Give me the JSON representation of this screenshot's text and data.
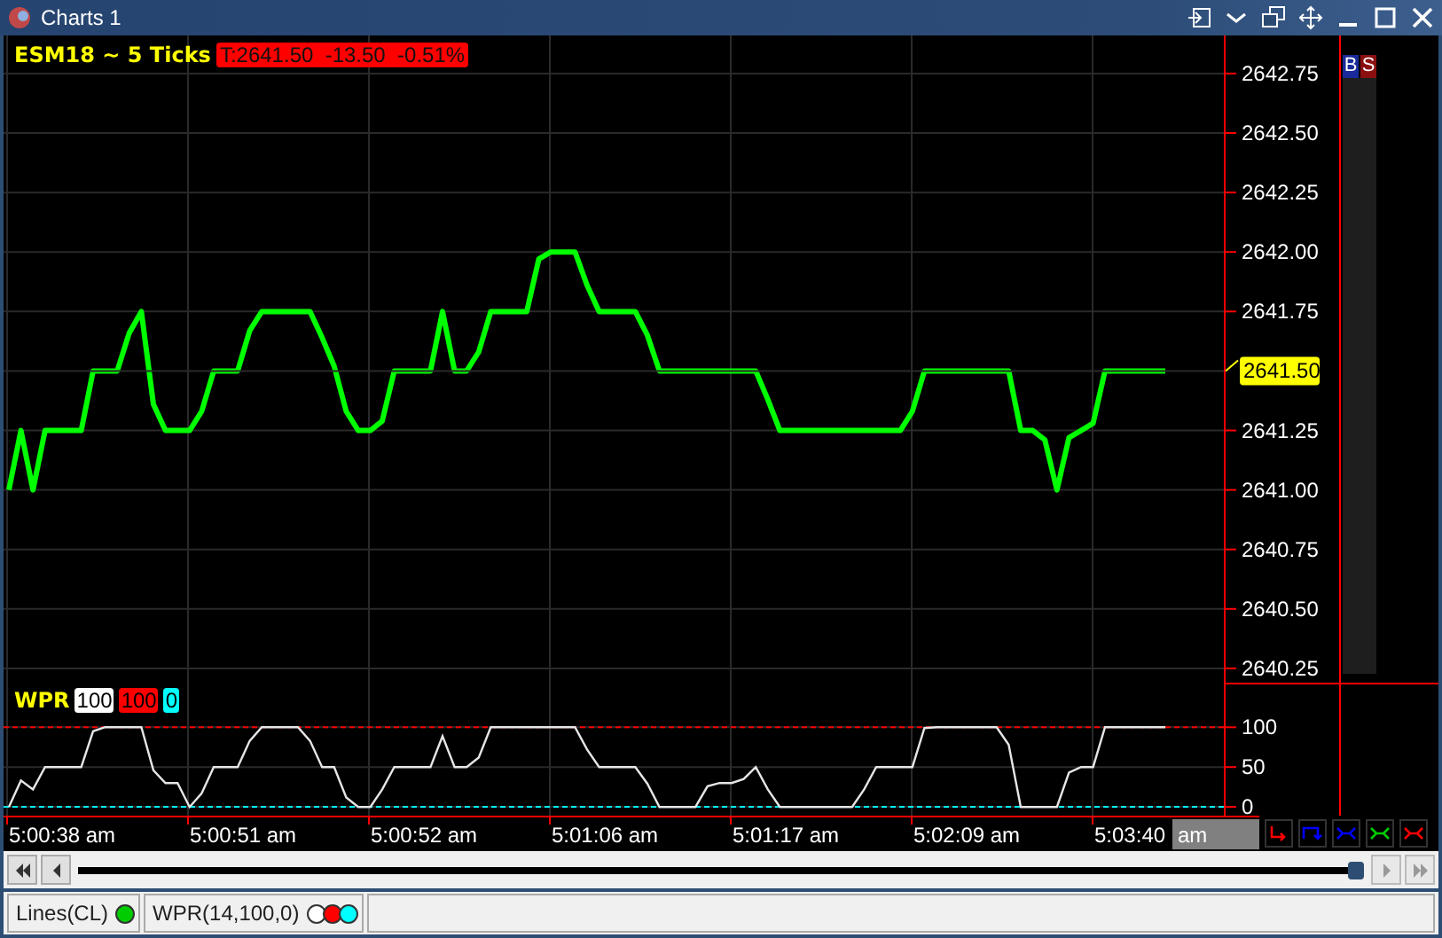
{
  "window": {
    "title": "Charts 1"
  },
  "price_pane": {
    "legend": {
      "quote": "T:2641.50  -13.50  -0.51%"
    },
    "chart_data": {
      "type": "line",
      "categories": [
        null,
        null,
        null,
        null,
        null,
        null,
        null,
        null,
        null,
        null,
        null,
        null,
        null,
        null,
        null,
        null,
        null,
        null,
        null,
        null,
        null,
        null,
        null,
        null,
        null,
        null,
        null,
        null,
        null,
        null,
        null,
        null,
        null,
        null,
        null,
        null,
        null,
        null,
        null,
        null,
        null,
        null,
        null,
        null,
        null,
        null,
        null,
        null,
        null,
        null,
        null,
        null,
        null,
        null,
        null,
        null,
        null,
        null,
        null,
        null,
        null,
        null,
        null,
        null,
        null,
        null,
        null,
        null,
        null,
        null,
        null,
        null,
        null,
        null,
        null,
        null,
        null,
        null,
        null,
        null,
        null,
        null,
        null,
        null,
        null,
        null,
        null,
        null,
        null,
        null,
        null,
        null,
        null,
        null,
        null,
        null,
        null
      ],
      "ylim": [
        2640.19,
        2642.91
      ],
      "yticks": [
        {
          "value": 2640.25,
          "label": "2640.25"
        },
        {
          "value": 2640.5,
          "label": "2640.50"
        },
        {
          "value": 2640.75,
          "label": "2640.75"
        },
        {
          "value": 2641,
          "label": "2641.00"
        },
        {
          "value": 2641.25,
          "label": "2641.25"
        },
        {
          "value": 2641.75,
          "label": "2641.75"
        },
        {
          "value": 2642,
          "label": "2642.00"
        },
        {
          "value": 2642.25,
          "label": "2642.25"
        },
        {
          "value": 2642.5,
          "label": "2642.50"
        },
        {
          "value": 2642.75,
          "label": "2642.75"
        }
      ],
      "series": [
        {
          "name": "ESM18 ~ 5 Ticks",
          "color": "#00ff00",
          "values": [
            2641,
            2641.25,
            2641,
            2641.25,
            2641.25,
            2641.25,
            2641.25,
            2641.5,
            2641.5,
            2641.5,
            2641.66,
            2641.75,
            2641.36,
            2641.25,
            2641.25,
            2641.25,
            2641.33,
            2641.5,
            2641.5,
            2641.5,
            2641.67,
            2641.75,
            2641.75,
            2641.75,
            2641.75,
            2641.75,
            2641.64,
            2641.52,
            2641.33,
            2641.25,
            2641.25,
            2641.29,
            2641.5,
            2641.5,
            2641.5,
            2641.5,
            2641.75,
            2641.5,
            2641.5,
            2641.58,
            2641.75,
            2641.75,
            2641.75,
            2641.75,
            2641.97,
            2642,
            2642,
            2642,
            2641.86,
            2641.75,
            2641.75,
            2641.75,
            2641.75,
            2641.65,
            2641.5,
            2641.5,
            2641.5,
            2641.5,
            2641.5,
            2641.5,
            2641.5,
            2641.5,
            2641.5,
            2641.38,
            2641.25,
            2641.25,
            2641.25,
            2641.25,
            2641.25,
            2641.25,
            2641.25,
            2641.25,
            2641.25,
            2641.25,
            2641.25,
            2641.33,
            2641.5,
            2641.5,
            2641.5,
            2641.5,
            2641.5,
            2641.5,
            2641.5,
            2641.5,
            2641.25,
            2641.25,
            2641.21,
            2641,
            2641.22,
            2641.25,
            2641.28,
            2641.5,
            2641.5,
            2641.5,
            2641.5,
            2641.5,
            2641.5
          ]
        }
      ],
      "annotations": [
        "2641.50"
      ],
      "grid": true
    }
  },
  "order_buttons": [
    {
      "label": "B",
      "color": "#1a2a9a"
    },
    {
      "label": "S",
      "color": "#8a1010"
    }
  ],
  "indicator_pane": {
    "legend": {
      "badges": [
        {
          "text": "100",
          "color": "#ffffff"
        },
        {
          "text": "100",
          "color": "#ff0000"
        },
        {
          "text": "0",
          "color": "#00ffff"
        }
      ]
    },
    "chart_data": {
      "type": "line",
      "categories": [
        null,
        null,
        null,
        null,
        null,
        null,
        null,
        null,
        null,
        null,
        null,
        null,
        null,
        null,
        null,
        null,
        null,
        null,
        null,
        null,
        null,
        null,
        null,
        null,
        null,
        null,
        null,
        null,
        null,
        null,
        null,
        null,
        null,
        null,
        null,
        null,
        null,
        null,
        null,
        null,
        null,
        null,
        null,
        null,
        null,
        null,
        null,
        null,
        null,
        null,
        null,
        null,
        null,
        null,
        null,
        null,
        null,
        null,
        null,
        null,
        null,
        null,
        null,
        null,
        null,
        null,
        null,
        null,
        null,
        null,
        null,
        null,
        null,
        null,
        null,
        null,
        null,
        null,
        null,
        null,
        null,
        null,
        null,
        null,
        null,
        null,
        null,
        null,
        null,
        null,
        null,
        null,
        null,
        null,
        null,
        null,
        null
      ],
      "ylim": [
        -11,
        156
      ],
      "yticks": [
        0,
        50,
        100
      ],
      "series": [
        {
          "name": "WPR",
          "color": "#e6e6e6",
          "values": [
            0,
            33,
            22,
            50,
            50,
            50,
            50,
            95,
            100,
            100,
            100,
            100,
            46,
            30,
            30,
            0,
            17,
            50,
            50,
            50,
            83,
            100,
            100,
            100,
            100,
            83,
            50,
            50,
            12,
            0,
            0,
            22,
            50,
            50,
            50,
            50,
            89,
            50,
            50,
            62,
            100,
            100,
            100,
            100,
            100,
            100,
            100,
            100,
            72,
            50,
            50,
            50,
            50,
            29,
            0,
            0,
            0,
            0,
            26,
            30,
            30,
            35,
            50,
            22,
            0,
            0,
            0,
            0,
            0,
            0,
            0,
            22,
            50,
            50,
            50,
            50,
            99,
            100,
            100,
            100,
            100,
            100,
            100,
            78,
            0,
            0,
            0,
            0,
            43,
            50,
            50,
            100,
            100,
            100,
            100,
            100,
            100
          ]
        }
      ],
      "ref_lines": [
        {
          "axis": "y",
          "value": 100,
          "color": "#ff0000"
        },
        {
          "axis": "y",
          "value": 0,
          "color": "#00ffff"
        }
      ],
      "grid": true
    }
  },
  "time_axis": {
    "labels": [
      "5:00:38 am",
      "5:00:51 am",
      "5:00:52 am",
      "5:01:06 am",
      "5:01:17 am",
      "5:02:09 am",
      "5:03:40"
    ],
    "cursor_label": "am"
  },
  "drawing_tools": [
    {
      "kind": "step-down",
      "color": "#ff0000"
    },
    {
      "kind": "step-up",
      "color": "#0000ff"
    },
    {
      "kind": "link",
      "color": "#0000ff"
    },
    {
      "kind": "link",
      "color": "#00cc00"
    },
    {
      "kind": "link",
      "color": "#ff0000"
    }
  ],
  "status_bar": [
    {
      "label": "Lines(CL)",
      "dots": [
        {
          "color": "#00cc00"
        }
      ]
    },
    {
      "label": "WPR(14,100,0)",
      "dots": [
        {
          "color": "#ffffff"
        },
        {
          "color": "#ff0000"
        },
        {
          "color": "#00ffff"
        }
      ]
    }
  ]
}
